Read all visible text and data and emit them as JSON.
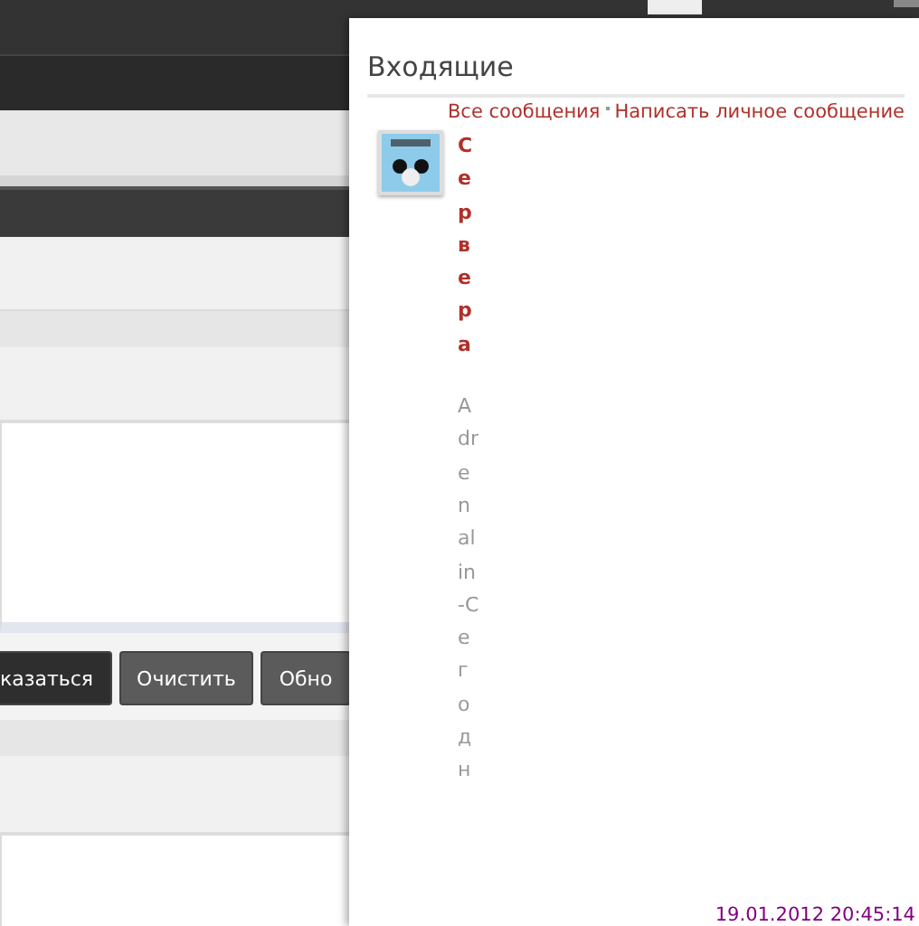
{
  "background": {
    "buttons": [
      {
        "label": "казаться",
        "selected": true
      },
      {
        "label": "Очистить",
        "selected": false
      },
      {
        "label": "Обно",
        "selected": false
      }
    ]
  },
  "inbox": {
    "title": "Входящие",
    "links": [
      "Все сообщения",
      "Написать личное сообщение"
    ],
    "messages": [
      {
        "sender": "Сервера",
        "subject": "Adrenalin-Сегодн",
        "time": "19.01.2012 20:45:14"
      }
    ]
  }
}
